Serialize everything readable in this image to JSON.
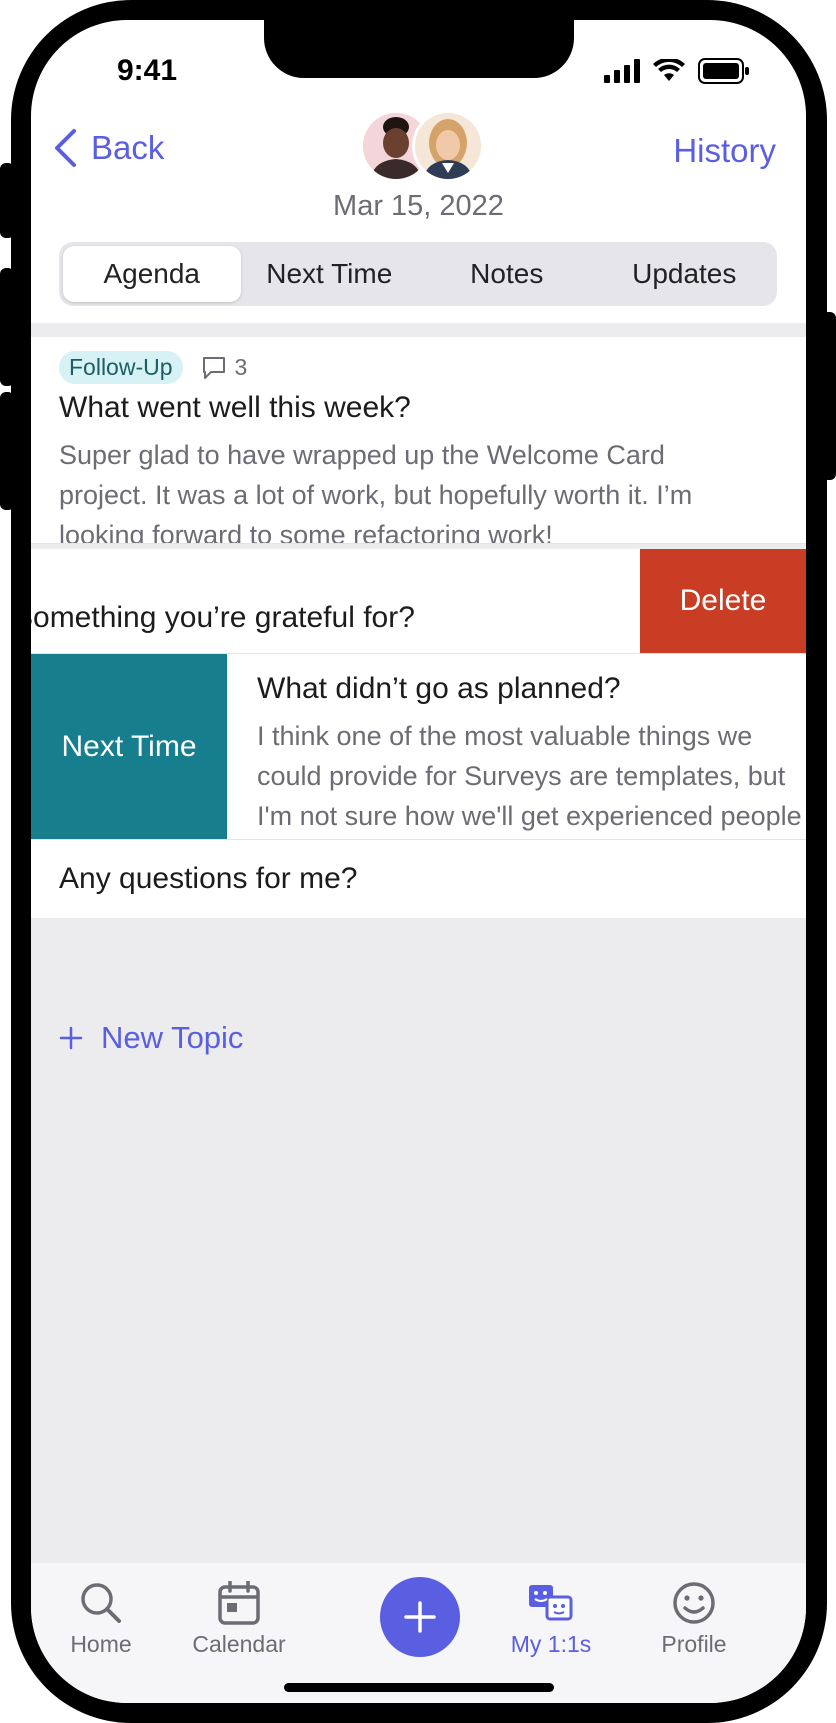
{
  "status": {
    "time": "9:41"
  },
  "header": {
    "back_label": "Back",
    "history_label": "History",
    "date": "Mar 15, 2022"
  },
  "tabs": [
    {
      "label": "Agenda",
      "active": true
    },
    {
      "label": "Next Time",
      "active": false
    },
    {
      "label": "Notes",
      "active": false
    },
    {
      "label": "Updates",
      "active": false
    }
  ],
  "topics": [
    {
      "tag": "Follow-Up",
      "comment_count": "3",
      "title": "What went well this week?",
      "body": "Super glad to have wrapped up the Welcome Card project. It was a lot of work, but hopefully worth it. I’m looking forward to some refactoring work!"
    },
    {
      "title": "Something you’re grateful for?",
      "swipe_action": "Delete"
    },
    {
      "title": "What didn’t go as planned?",
      "body": "I think one of the most valuable things we could provide for Surveys are templates, but I'm not sure how we'll get experienced people to",
      "swipe_action": "Next Time"
    },
    {
      "title": "Any questions for me?"
    }
  ],
  "new_topic_label": "New Topic",
  "tabbar": {
    "home": "Home",
    "calendar": "Calendar",
    "my_ones": "My 1:1s",
    "profile": "Profile"
  },
  "colors": {
    "accent": "#5a5ee0",
    "delete": "#c93d25",
    "next_time": "#167e8d",
    "tag_bg": "#d6f2f4"
  }
}
